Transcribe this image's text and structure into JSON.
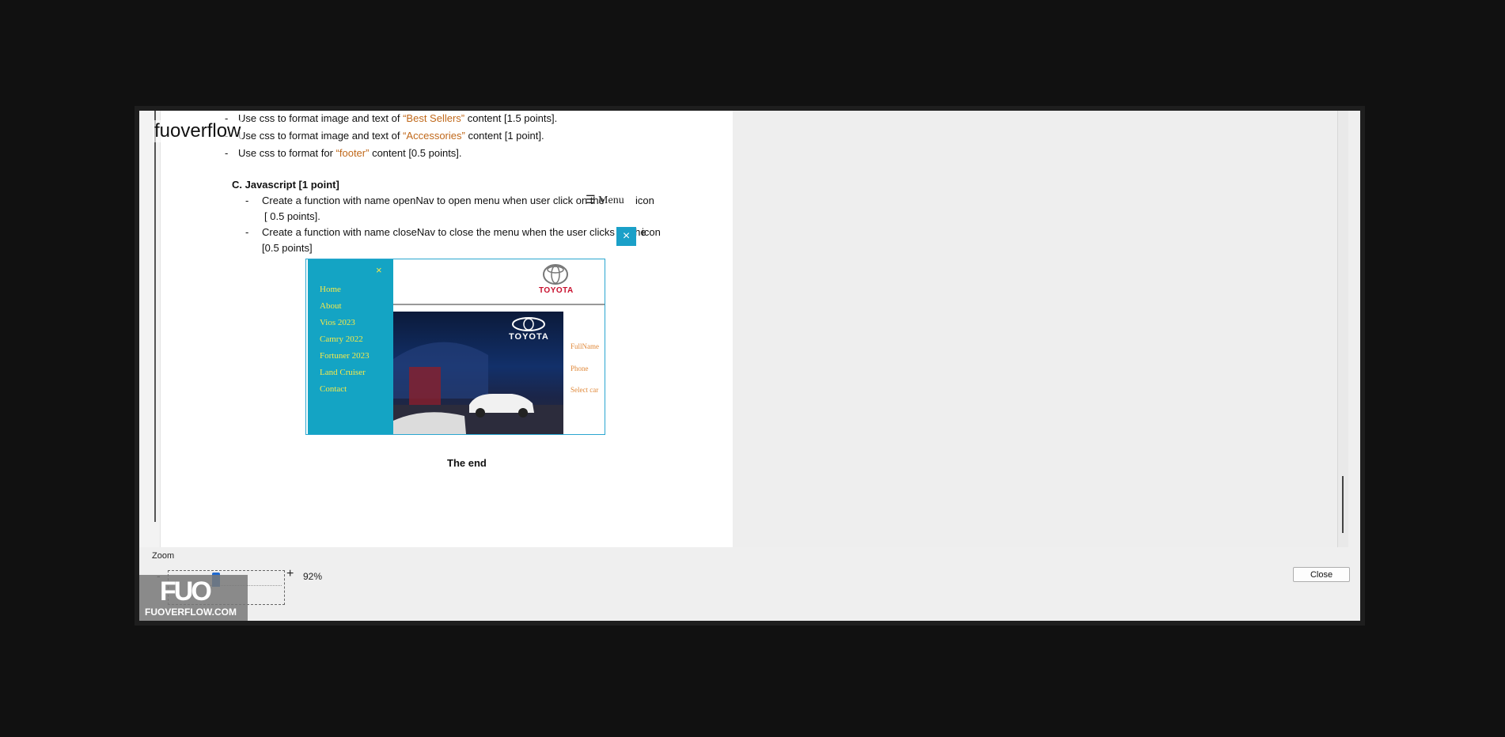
{
  "document": {
    "line1": {
      "prefix": "Use css  to format  image and text of ",
      "highlight": "“Best Sellers”",
      "suffix": " content [1.5 points]."
    },
    "line2": {
      "prefix": "Use css  to format  image and text of ",
      "highlight": "“Accessories”",
      "suffix": " content [1 point]."
    },
    "line3": {
      "prefix": "Use css  to format  for ",
      "highlight": "“footer”",
      "suffix": " content [0.5 points]."
    },
    "section_c": "C.  Javascript [1 point]",
    "bullet1_a": "Create a function with name openNav to open menu when user click on the",
    "bullet1_icon": "☰ Menu",
    "bullet1_icon_word": "icon",
    "bullet1_b": "[ 0.5 points].",
    "bullet2_a": "Create a function with name closeNav to close the menu when the user clicks on the",
    "bullet2_icon": "×",
    "bullet2_icon_word": "icon",
    "bullet2_b": "[0.5 points]",
    "the_end": "The end",
    "dash": "-"
  },
  "figure": {
    "close_symbol": "×",
    "nav_items": [
      "Home",
      "About",
      "Vios 2023",
      "Camry 2022",
      "Fortuner 2023",
      "Land Cruiser",
      "Contact"
    ],
    "brand": "TOYOTA",
    "photo_wordmark": "TOYOTA",
    "form_labels": [
      "FullName",
      "Phone",
      "Select car"
    ]
  },
  "overlay": {
    "brand_top": "fuoverflow",
    "watermark_logo": "FUO",
    "watermark_url": "FUOVERFLOW.COM"
  },
  "zoom": {
    "label": "Zoom",
    "minus": "-",
    "plus": "+",
    "value": "92%",
    "level_percent": 92
  },
  "buttons": {
    "close": "Close"
  },
  "colors": {
    "accent_orange": "#c0681a",
    "nav_bg": "#14a4c4",
    "nav_text": "#f6e94a",
    "toyota_red": "#c8102e",
    "slider_blue": "#1f6ad1"
  }
}
